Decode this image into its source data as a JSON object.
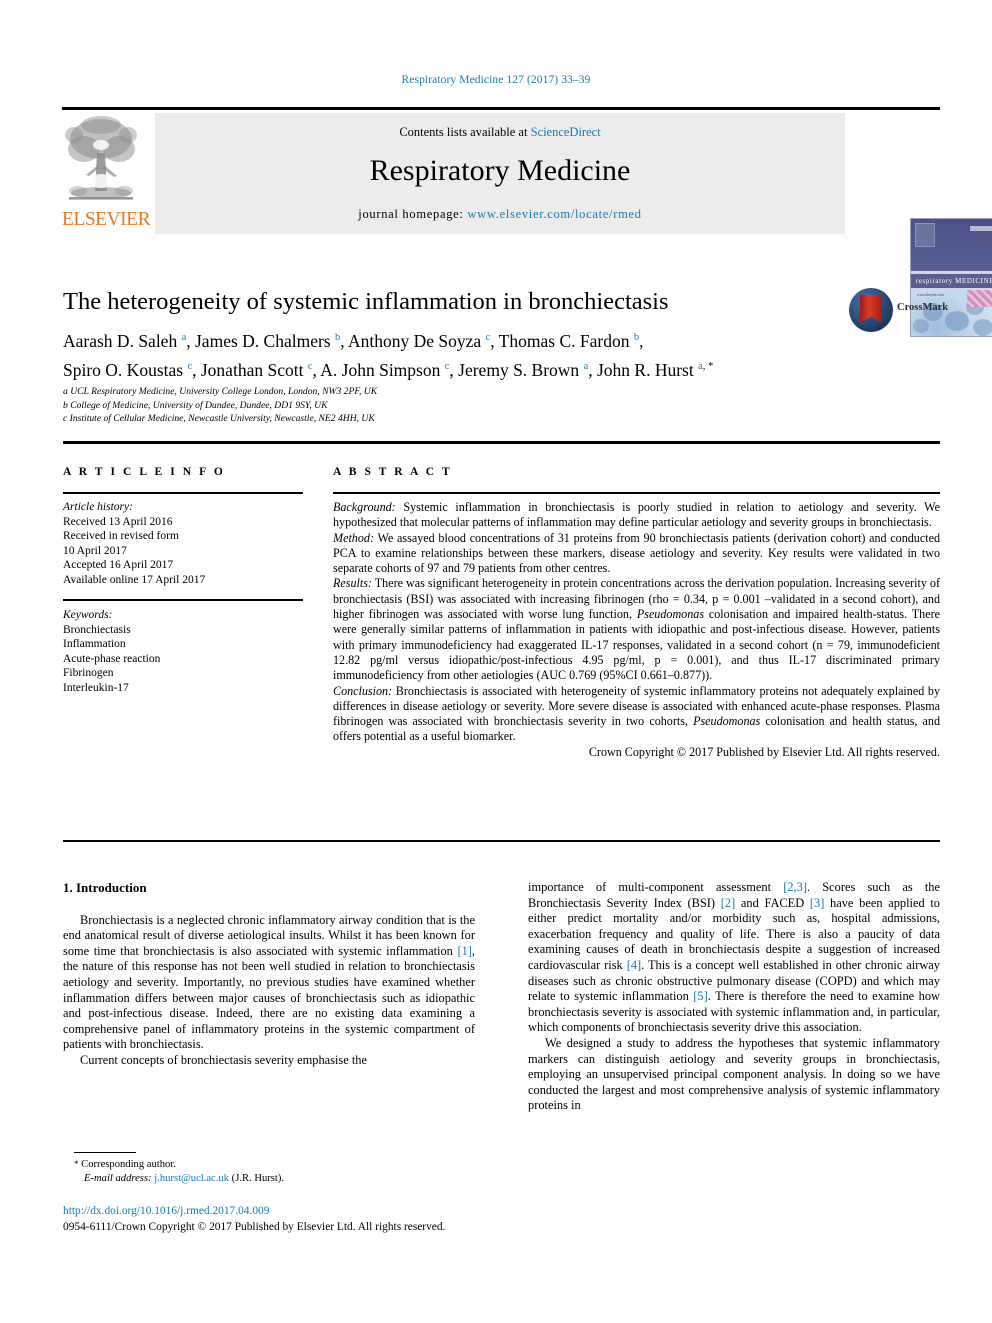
{
  "running_head": "Respiratory Medicine 127 (2017) 33–39",
  "masthead": {
    "publisher_name": "ELSEVIER",
    "contents_prefix": "Contents lists available at ",
    "contents_link": "ScienceDirect",
    "journal_title": "Respiratory Medicine",
    "homepage_label": "journal homepage: ",
    "homepage_url": "www.elsevier.com/locate/rmed",
    "cover_journal_name": "respiratory MEDICINE",
    "cover_sub": "www.elsevier.com"
  },
  "article": {
    "title": "The heterogeneity of systemic inflammation in bronchiectasis",
    "crossmark_label": "CrossMark",
    "authors_line1": "Aarash D. Saleh a, James D. Chalmers b, Anthony De Soyza c, Thomas C. Fardon b,",
    "authors_line2": "Spiro O. Koustas c, Jonathan Scott c, A. John Simpson c, Jeremy S. Brown a, John R. Hurst a, *",
    "affiliations": [
      "a UCL Respiratory Medicine, University College London, London, NW3 2PF, UK",
      "b College of Medicine, University of Dundee, Dundee, DD1 9SY, UK",
      "c Institute of Cellular Medicine, Newcastle University, Newcastle, NE2 4HH, UK"
    ]
  },
  "article_info": {
    "heading": "A R T I C L E   I N F O",
    "history_label": "Article history:",
    "history": [
      "Received 13 April 2016",
      "Received in revised form",
      "10 April 2017",
      "Accepted 16 April 2017",
      "Available online 17 April 2017"
    ],
    "keywords_label": "Keywords:",
    "keywords": [
      "Bronchiectasis",
      "Inflammation",
      "Acute-phase reaction",
      "Fibrinogen",
      "Interleukin-17"
    ]
  },
  "abstract": {
    "heading": "A B S T R A C T",
    "background_label": "Background:",
    "background_text": " Systemic inflammation in bronchiectasis is poorly studied in relation to aetiology and severity. We hypothesized that molecular patterns of inflammation may define particular aetiology and severity groups in bronchiectasis.",
    "method_label": "Method:",
    "method_text": " We assayed blood concentrations of 31 proteins from 90 bronchiectasis patients (derivation cohort) and conducted PCA to examine relationships between these markers, disease aetiology and severity. Key results were validated in two separate cohorts of 97 and 79 patients from other centres.",
    "results_label": "Results:",
    "results_text_1": " There was significant heterogeneity in protein concentrations across the derivation population. Increasing severity of bronchiectasis (BSI) was associated with increasing fibrinogen (rho = 0.34, p = 0.001 –validated in a second cohort), and higher fibrinogen was associated with worse lung function, ",
    "results_italic_1": "Pseudomonas",
    "results_text_2": " colonisation and impaired health-status. There were generally similar patterns of inflammation in patients with idiopathic and post-infectious disease. However, patients with primary immunodeficiency had exaggerated IL-17 responses, validated in a second cohort (n = 79, immunodeficient 12.82 pg/ml versus idiopathic/post-infectious 4.95 pg/ml, p = 0.001), and thus IL-17 discriminated primary immunodeficiency from other aetiologies (AUC 0.769 (95%CI 0.661–0.877)).",
    "conclusion_label": "Conclusion:",
    "conclusion_text_1": " Bronchiectasis is associated with heterogeneity of systemic inflammatory proteins not adequately explained by differences in disease aetiology or severity. More severe disease is associated with enhanced acute-phase responses. Plasma fibrinogen was associated with bronchiectasis severity in two cohorts, ",
    "conclusion_italic_1": "Pseudomonas",
    "conclusion_text_2": " colonisation and health status, and offers potential as a useful biomarker.",
    "copyright": "Crown Copyright © 2017 Published by Elsevier Ltd. All rights reserved."
  },
  "introduction": {
    "section_heading": "1. Introduction",
    "left_paragraph_1": "Bronchiectasis is a neglected chronic inflammatory airway condition that is the end anatomical result of diverse aetiological insults. Whilst it has been known for some time that bronchiectasis is also associated with systemic inflammation [1], the nature of this response has not been well studied in relation to bronchiectasis aetiology and severity. Importantly, no previous studies have examined whether inflammation differs between major causes of bronchiectasis such as idiopathic and post-infectious disease. Indeed, there are no existing data examining a comprehensive panel of inflammatory proteins in the systemic compartment of patients with bronchiectasis.",
    "left_paragraph_2": "Current concepts of bronchiectasis severity emphasise the",
    "right_paragraph_1": "importance of multi-component assessment [2,3]. Scores such as the Bronchiectasis Severity Index (BSI) [2] and FACED [3] have been applied to either predict mortality and/or morbidity such as, hospital admissions, exacerbation frequency and quality of life. There is also a paucity of data examining causes of death in bronchiectasis despite a suggestion of increased cardiovascular risk [4]. This is a concept well established in other chronic airway diseases such as chronic obstructive pulmonary disease (COPD) and which may relate to systemic inflammation [5]. There is therefore the need to examine how bronchiectasis severity is associated with systemic inflammation and, in particular, which components of bronchiectasis severity drive this association.",
    "right_paragraph_2": "We designed a study to address the hypotheses that systemic inflammatory markers can distinguish aetiology and severity groups in bronchiectasis, employing an unsupervised principal component analysis. In doing so we have conducted the largest and most comprehensive analysis of systemic inflammatory proteins in"
  },
  "footer": {
    "corresponding_star": "*",
    "corresponding_label": " Corresponding author.",
    "email_label": "E-mail address:",
    "email": "j.hurst@ucl.ac.uk",
    "email_suffix": " (J.R. Hurst).",
    "doi": "http://dx.doi.org/10.1016/j.rmed.2017.04.009",
    "issn_line": "0954-6111/Crown Copyright © 2017 Published by Elsevier Ltd. All rights reserved."
  },
  "colors": {
    "link": "#1a7aad",
    "elsevier_orange": "#e87722",
    "banner_grey": "#ececec"
  }
}
